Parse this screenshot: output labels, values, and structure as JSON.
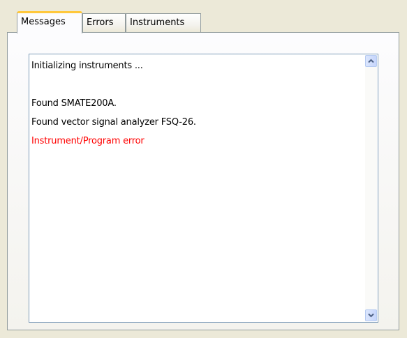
{
  "tabs": [
    {
      "label": "Messages",
      "active": true
    },
    {
      "label": "Errors",
      "active": false
    },
    {
      "label": "Instruments",
      "active": false
    }
  ],
  "messages": [
    {
      "text": "Initializing instruments ...",
      "color": "#000000"
    },
    {
      "text": "",
      "color": "#000000"
    },
    {
      "text": "Found SMATE200A.",
      "color": "#000000"
    },
    {
      "text": "Found vector signal analyzer FSQ-26.",
      "color": "#000000"
    },
    {
      "text": "Instrument/Program error",
      "color": "#ff0000"
    }
  ],
  "scrollbar": {
    "up_icon": "chevron-up-icon",
    "down_icon": "chevron-down-icon"
  },
  "colors": {
    "active_tab_accent": "#ffc83c",
    "error_text": "#ff0000",
    "window_bg": "#ece9d8"
  }
}
